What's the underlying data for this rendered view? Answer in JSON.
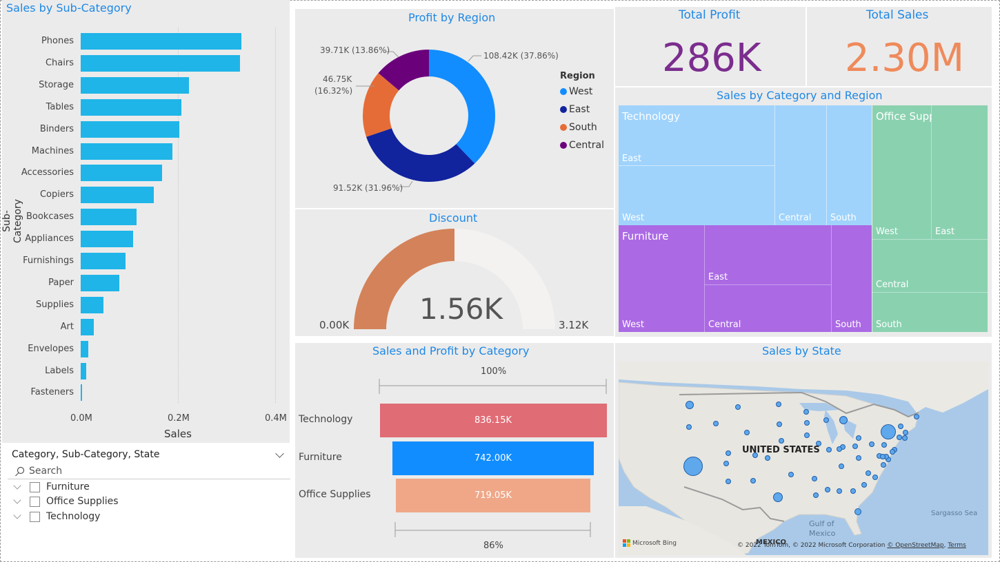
{
  "sales_by_subcategory": {
    "title": "Sales by Sub-Category",
    "ylabel": "Sub-Category",
    "xlabel": "Sales",
    "ticks": [
      "0.0M",
      "0.2M",
      "0.4M"
    ]
  },
  "profit_by_region": {
    "title": "Profit by Region",
    "legend_title": "Region",
    "labels": {
      "west": "108.42K (37.86%)",
      "central": "39.71K (13.86%)",
      "south_l1": "46.75K",
      "south_l2": "(16.32%)",
      "east": "91.52K (31.96%)"
    },
    "legend": [
      {
        "name": "West",
        "color": "#118dff"
      },
      {
        "name": "East",
        "color": "#12239e"
      },
      {
        "name": "South",
        "color": "#e66c37"
      },
      {
        "name": "Central",
        "color": "#6b007b"
      }
    ]
  },
  "cards": {
    "total_profit": {
      "label": "Total Profit",
      "value": "286K",
      "color": "#7b2d8e"
    },
    "total_sales": {
      "label": "Total Sales",
      "value": "2.30M",
      "color": "#ef8a5b"
    }
  },
  "treemap": {
    "title": "Sales by Category and Region",
    "technology": {
      "label": "Technology",
      "east": "East",
      "west": "West",
      "central": "Central",
      "south": "South"
    },
    "furniture": {
      "label": "Furniture",
      "west": "West",
      "east": "East",
      "central": "Central",
      "south": "South"
    },
    "office": {
      "label": "Office Supplies",
      "west": "West",
      "east": "East",
      "central": "Central",
      "south": "South"
    }
  },
  "discount": {
    "title": "Discount",
    "value": "1.56K",
    "min": "0.00K",
    "max": "3.12K",
    "fill_fraction": 0.5
  },
  "sales_profit_category": {
    "title": "Sales and Profit by Category",
    "top_pct": "100%",
    "bottom_pct": "86%",
    "rows": [
      {
        "label": "Technology",
        "value": "836.15K",
        "color": "#e06c75"
      },
      {
        "label": "Furniture",
        "value": "742.00K",
        "color": "#118dff"
      },
      {
        "label": "Office Supplies",
        "value": "719.05K",
        "color": "#efa788"
      }
    ]
  },
  "map": {
    "title": "Sales by State",
    "country": "UNITED STATES",
    "gulf_l1": "Gulf of",
    "gulf_l2": "Mexico",
    "sargasso": "Sargasso Sea",
    "mexico": "MEXICO",
    "attribution": "© 2022 TomTom, © 2022 Microsoft Corporation",
    "osm": "© OpenStreetMap",
    "terms": "Terms",
    "bing": "Microsoft Bing"
  },
  "slicer": {
    "header": "Category, Sub-Category, State",
    "search_placeholder": "Search",
    "items": [
      "Furniture",
      "Office Supplies",
      "Technology"
    ]
  },
  "chart_data": [
    {
      "type": "bar",
      "title": "Sales by Sub-Category",
      "xlabel": "Sales",
      "ylabel": "Sub-Category",
      "xlim": [
        0,
        0.4
      ],
      "unit": "M",
      "categories": [
        "Phones",
        "Chairs",
        "Storage",
        "Tables",
        "Binders",
        "Machines",
        "Accessories",
        "Copiers",
        "Bookcases",
        "Appliances",
        "Furnishings",
        "Paper",
        "Supplies",
        "Art",
        "Envelopes",
        "Labels",
        "Fasteners"
      ],
      "values": [
        0.33,
        0.328,
        0.223,
        0.207,
        0.203,
        0.189,
        0.167,
        0.15,
        0.115,
        0.108,
        0.092,
        0.079,
        0.047,
        0.027,
        0.016,
        0.012,
        0.003
      ]
    },
    {
      "type": "pie",
      "title": "Profit by Region",
      "categories": [
        "West",
        "East",
        "South",
        "Central"
      ],
      "values": [
        108.42,
        91.52,
        46.75,
        39.71
      ],
      "unit": "K"
    },
    {
      "type": "bar",
      "title": "Sales and Profit by Category",
      "categories": [
        "Technology",
        "Furniture",
        "Office Supplies"
      ],
      "values": [
        836.15,
        742.0,
        719.05
      ],
      "unit": "K"
    }
  ]
}
